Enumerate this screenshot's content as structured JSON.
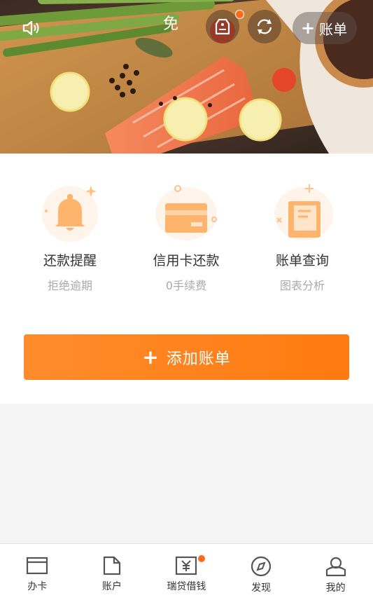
{
  "header": {
    "free_label": "免",
    "add_bill_label": "账单",
    "notification_dot": true
  },
  "features": [
    {
      "title": "还款提醒",
      "subtitle": "拒绝逾期",
      "icon": "bell-icon"
    },
    {
      "title": "信用卡还款",
      "subtitle": "0手续费",
      "icon": "credit-card-icon"
    },
    {
      "title": "账单查询",
      "subtitle": "图表分析",
      "icon": "bill-document-icon"
    }
  ],
  "add_bill_button": "添加账单",
  "tabs": [
    {
      "label": "办卡",
      "icon": "card-window-icon"
    },
    {
      "label": "账户",
      "icon": "document-icon"
    },
    {
      "label": "瑞贷借钱",
      "icon": "loan-yen-icon",
      "badge": true
    },
    {
      "label": "发现",
      "icon": "compass-icon"
    },
    {
      "label": "我的",
      "icon": "profile-icon"
    }
  ],
  "colors": {
    "accent": "#ff7a10",
    "badge": "#ff6a1a",
    "icon_light": "#ffc08a"
  }
}
